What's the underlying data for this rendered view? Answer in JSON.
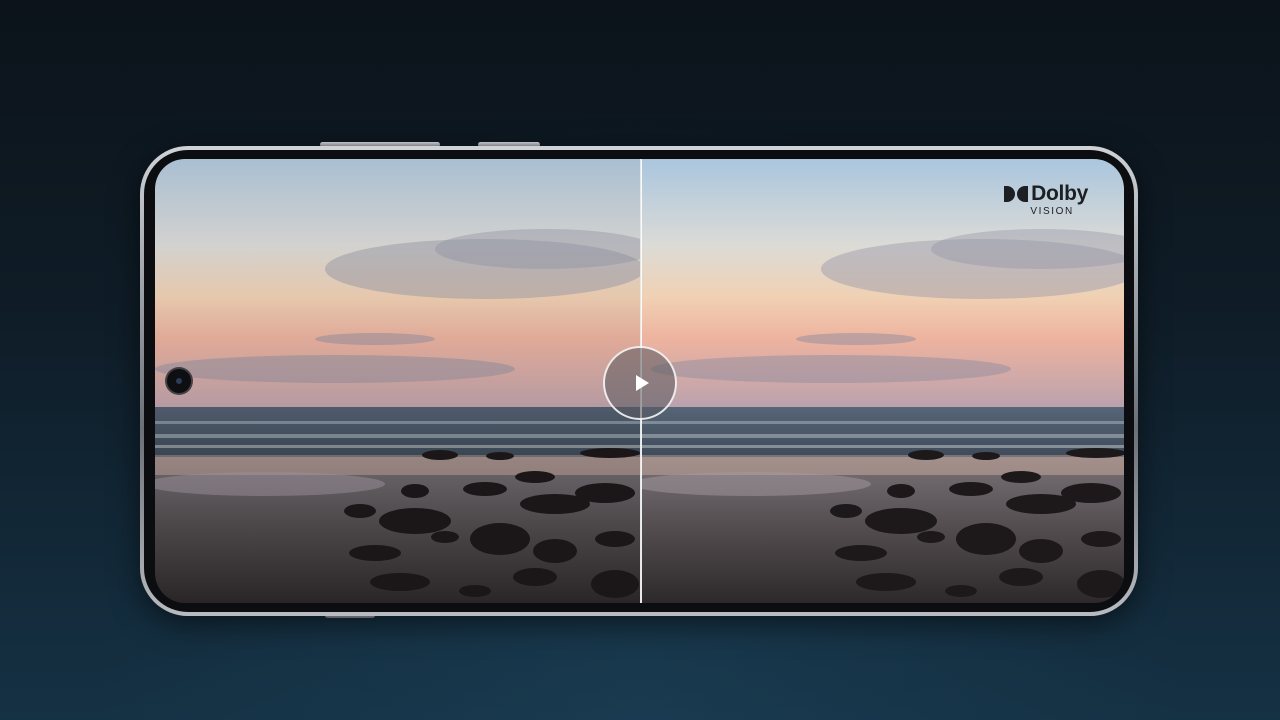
{
  "video": {
    "badge": {
      "brand": "Dolby",
      "subtitle": "VISION",
      "icon": "dolby-double-d-icon"
    },
    "play_icon": "play-icon",
    "comparison": {
      "left": "standard",
      "right": "dolby-vision"
    }
  },
  "colors": {
    "background_top": "#0c131a",
    "background_bottom": "#153144",
    "phone_frame": "#9aa0a6",
    "divider": "#ffffff"
  }
}
